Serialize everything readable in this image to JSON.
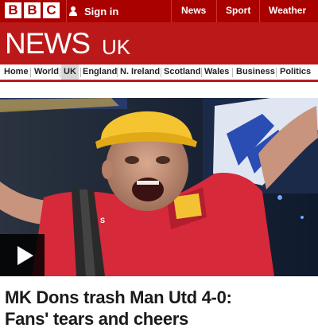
{
  "top_bar": {
    "logo_letters": [
      "B",
      "B",
      "C"
    ],
    "sign_in_label": "Sign in",
    "nav": [
      "News",
      "Sport",
      "Weather"
    ]
  },
  "banner": {
    "news_label": "NEWS",
    "region_label": "UK"
  },
  "section_nav": {
    "items": [
      "Home",
      "World",
      "UK",
      "England",
      "N. Ireland",
      "Scotland",
      "Wales",
      "Business",
      "Politics"
    ],
    "active": "UK"
  },
  "hero": {
    "media_type": "video",
    "play_icon": "play-icon"
  },
  "article": {
    "headline_line1": "MK Dons trash Man Utd 4-0:",
    "headline_line2": "Fans' tears and cheers"
  },
  "colors": {
    "top_bar": "#a90000",
    "banner": "#bb1919",
    "accent": "#bb1919"
  }
}
